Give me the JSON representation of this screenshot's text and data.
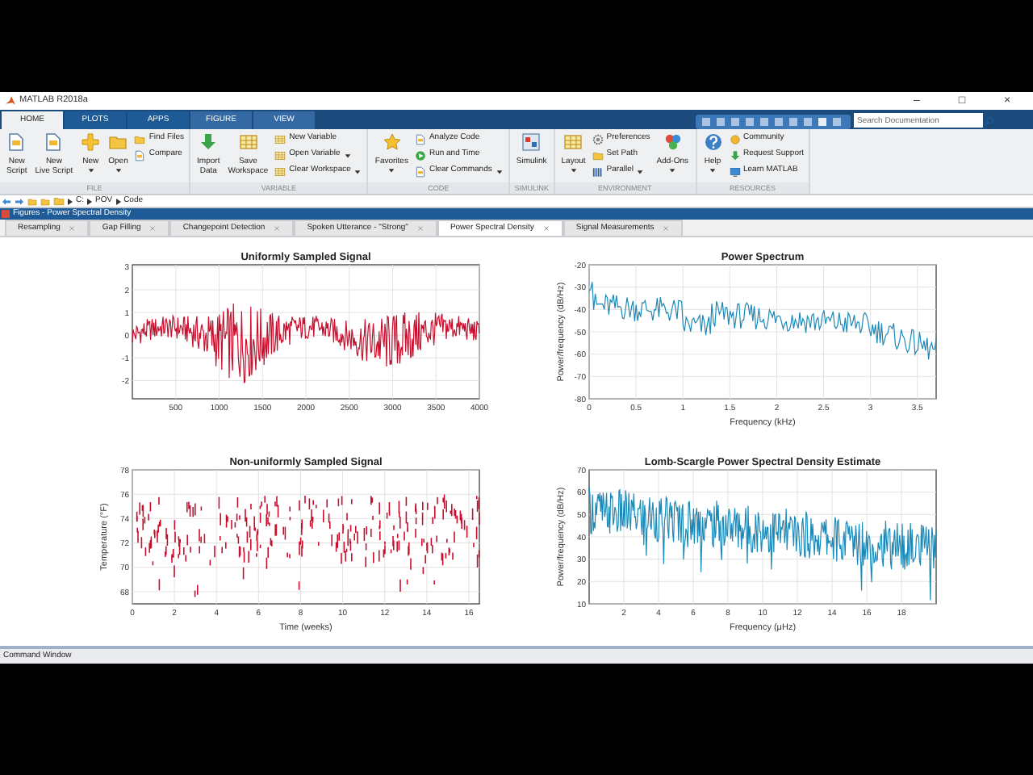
{
  "window": {
    "title": "MATLAB R2018a",
    "controls": [
      "–",
      "□",
      "×"
    ]
  },
  "ribbon_tabs": [
    {
      "label": "HOME",
      "selected": true,
      "contextual": false
    },
    {
      "label": "PLOTS",
      "selected": false,
      "contextual": false
    },
    {
      "label": "APPS",
      "selected": false,
      "contextual": false
    },
    {
      "label": "FIGURE",
      "selected": false,
      "contextual": true
    },
    {
      "label": "VIEW",
      "selected": false,
      "contextual": true
    }
  ],
  "search": {
    "placeholder": "Search Documentation"
  },
  "toolstrip": [
    {
      "label": "FILE",
      "items": [
        {
          "kind": "large",
          "lines": [
            "New",
            "Script"
          ],
          "dropdown": false
        },
        {
          "kind": "large",
          "lines": [
            "New",
            "Live Script"
          ],
          "dropdown": false
        },
        {
          "kind": "large",
          "lines": [
            "New"
          ],
          "dropdown": true
        },
        {
          "kind": "large",
          "lines": [
            "Open"
          ],
          "dropdown": true
        },
        {
          "kind": "stack",
          "items": [
            {
              "label": "Find Files",
              "dropdown": false
            },
            {
              "label": "Compare",
              "dropdown": false
            }
          ]
        }
      ]
    },
    {
      "label": "VARIABLE",
      "items": [
        {
          "kind": "large",
          "lines": [
            "Import",
            "Data"
          ],
          "dropdown": false
        },
        {
          "kind": "large",
          "lines": [
            "Save",
            "Workspace"
          ],
          "dropdown": false
        },
        {
          "kind": "stack",
          "items": [
            {
              "label": "New Variable",
              "dropdown": false
            },
            {
              "label": "Open Variable",
              "dropdown": true
            },
            {
              "label": "Clear Workspace",
              "dropdown": true
            }
          ]
        }
      ]
    },
    {
      "label": "CODE",
      "items": [
        {
          "kind": "large",
          "lines": [
            "Favorites"
          ],
          "dropdown": true
        },
        {
          "kind": "stack",
          "items": [
            {
              "label": "Analyze Code",
              "dropdown": false
            },
            {
              "label": "Run and Time",
              "dropdown": false
            },
            {
              "label": "Clear Commands",
              "dropdown": true
            }
          ]
        }
      ]
    },
    {
      "label": "SIMULINK",
      "items": [
        {
          "kind": "large",
          "lines": [
            "Simulink"
          ],
          "dropdown": false
        }
      ]
    },
    {
      "label": "ENVIRONMENT",
      "items": [
        {
          "kind": "large",
          "lines": [
            "Layout"
          ],
          "dropdown": true
        },
        {
          "kind": "stack",
          "items": [
            {
              "label": "Preferences",
              "dropdown": false
            },
            {
              "label": "Set Path",
              "dropdown": false
            },
            {
              "label": "Parallel",
              "dropdown": true
            }
          ]
        },
        {
          "kind": "large",
          "lines": [
            "Add-Ons"
          ],
          "dropdown": true
        }
      ]
    },
    {
      "label": "RESOURCES",
      "items": [
        {
          "kind": "large",
          "lines": [
            "Help"
          ],
          "dropdown": true
        },
        {
          "kind": "stack",
          "items": [
            {
              "label": "Community",
              "dropdown": false
            },
            {
              "label": "Request Support",
              "dropdown": false
            },
            {
              "label": "Learn MATLAB",
              "dropdown": false
            }
          ]
        }
      ]
    }
  ],
  "address_bar": {
    "path": [
      "C:",
      "POV",
      "Code"
    ]
  },
  "figures_panel": {
    "title": "Figures - Power Spectral Density"
  },
  "figure_tabs": [
    {
      "label": "Resampling",
      "selected": false
    },
    {
      "label": "Gap Filling",
      "selected": false
    },
    {
      "label": "Changepoint Detection",
      "selected": false
    },
    {
      "label": "Spoken Utterance - \"Strong\"",
      "selected": false
    },
    {
      "label": "Power Spectral Density",
      "selected": true
    },
    {
      "label": "Signal Measurements",
      "selected": false
    }
  ],
  "plots": [
    {
      "kind": "line",
      "title": "Uniformly Sampled Signal",
      "color": "#c8102e",
      "xticks": [
        "500",
        "1000",
        "1500",
        "2000",
        "2500",
        "3000",
        "3500",
        "4000"
      ],
      "yticks": [
        "3",
        "2",
        "1",
        "0",
        "-1",
        "-2"
      ]
    },
    {
      "kind": "line",
      "title": "Power Spectrum",
      "color": "#1b8ab8",
      "xlabel": "Frequency (kHz)",
      "ylabel": "Power/frequency (dB/Hz)",
      "xticks": [
        "0",
        "0.5",
        "1",
        "1.5",
        "2",
        "2.5",
        "3",
        "3.5"
      ],
      "yticks": [
        "-20",
        "-30",
        "-40",
        "-50",
        "-60",
        "-70",
        "-80"
      ]
    },
    {
      "kind": "segments",
      "title": "Non-uniformly Sampled Signal",
      "color": "#c8102e",
      "xlabel": "Time (weeks)",
      "ylabel": "Temperature (°F)",
      "xticks": [
        "0",
        "2",
        "4",
        "6",
        "8",
        "10",
        "12",
        "14",
        "16"
      ],
      "yticks": [
        "78",
        "76",
        "74",
        "72",
        "70",
        "68"
      ]
    },
    {
      "kind": "line",
      "title": "Lomb-Scargle Power Spectral Density Estimate",
      "color": "#1b8ab8",
      "xlabel": "Frequency (μHz)",
      "ylabel": "Power/frequency (dB/Hz)",
      "xticks": [
        "2",
        "4",
        "6",
        "8",
        "10",
        "12",
        "14",
        "16",
        "18"
      ],
      "yticks": [
        "70",
        "60",
        "50",
        "40",
        "30",
        "20",
        "10"
      ]
    }
  ],
  "command_window": {
    "title": "Command Window"
  }
}
